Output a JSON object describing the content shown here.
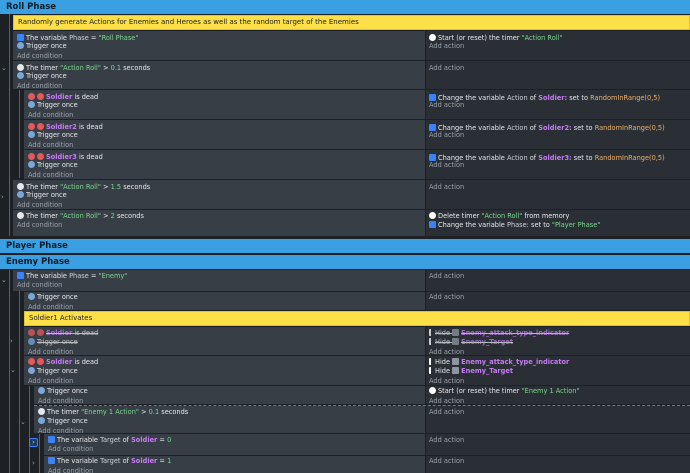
{
  "groups": {
    "roll": "Roll Phase",
    "player": "Player Phase",
    "enemy": "Enemy Phase"
  },
  "comments": {
    "roll": "Randomly generate Actions for Enemies and Heroes as well as the random target of the Enemies",
    "soldier1": "Soldier1 Activates"
  },
  "common": {
    "add_condition": "Add condition",
    "add_action": "Add action",
    "trigger_once": "Trigger once",
    "the_variable": "The variable",
    "the_timer": "The timer",
    "is_dead": "is dead",
    "change_variable": "Change the variable",
    "of": "of",
    "set_to": "set to",
    "seconds": "seconds",
    "hide": "Hide",
    "start_timer": "Start (or reset) the timer",
    "delete_timer": "Delete timer",
    "from_memory": "from memory",
    "gt": ">",
    "eq": "="
  },
  "events": {
    "e1": {
      "var": "Phase",
      "value": "\"Roll Phase\"",
      "action_timer": "\"Action Roll\""
    },
    "e2": {
      "timer": "\"Action Roll\"",
      "value": "0.1"
    },
    "e3": {
      "obj": "Soldier",
      "var": "Action",
      "fn": "RandomInRange(0,5)"
    },
    "e4": {
      "obj": "Soldier2",
      "var": "Action",
      "fn": "RandomInRange(0,5)"
    },
    "e5": {
      "obj": "Soldier3",
      "var": "Action",
      "fn": "RandomInRange(0,5)"
    },
    "e6": {
      "timer": "\"Action Roll\"",
      "value": "1.5"
    },
    "e7": {
      "timer": "\"Action Roll\"",
      "value": "2",
      "del_timer": "\"Action Roll\"",
      "var": "Phase",
      "set_value": "\"Player Phase\""
    },
    "e8": {
      "var": "Phase",
      "value": "\"Enemy\""
    },
    "e10": {
      "obj": "Soldier",
      "hide1": "Enemy_attack_type_indicator",
      "hide2": "Enemy_Target"
    },
    "e11": {
      "obj": "Soldier",
      "hide1": "Enemy_attack_type_indicator",
      "hide2": "Enemy_Target"
    },
    "e12": {
      "start_timer": "\"Enemy 1 Action\""
    },
    "e13": {
      "timer": "\"Enemy 1 Action\"",
      "value": "0.1"
    },
    "e14": {
      "var": "Target",
      "obj": "Soldier",
      "value": "0"
    },
    "e15": {
      "var": "Target",
      "obj": "Soldier",
      "value": "1"
    }
  },
  "icons": [
    "variable-icon",
    "trigger-icon",
    "timer-icon",
    "dead-icon",
    "hide-icon",
    "sprite-icon",
    "start-icon"
  ]
}
